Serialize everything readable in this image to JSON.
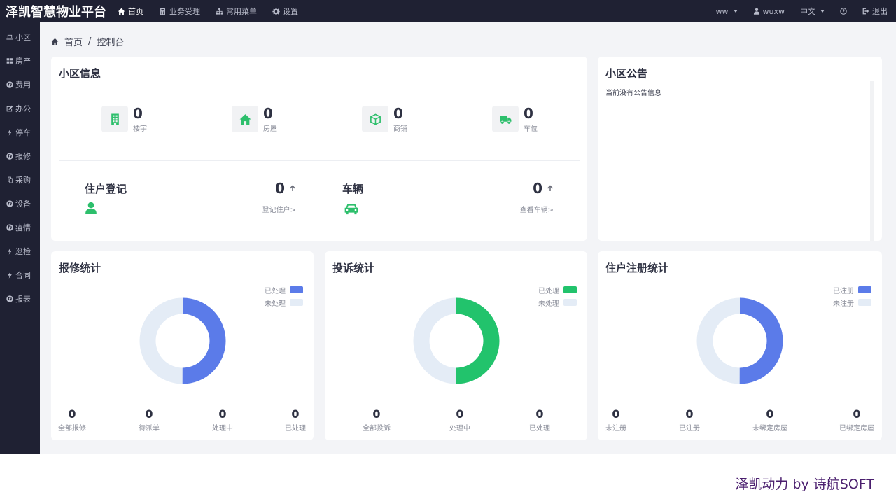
{
  "app": {
    "title": "泽凯智慧物业平台"
  },
  "topnav": [
    {
      "label": "首页",
      "icon": "home-icon",
      "active": true
    },
    {
      "label": "业务受理",
      "icon": "calculator-icon",
      "active": false
    },
    {
      "label": "常用菜单",
      "icon": "sitemap-icon",
      "active": false
    },
    {
      "label": "设置",
      "icon": "gear-icon",
      "active": false
    }
  ],
  "rightnav": {
    "community": "ww",
    "user": "wuxw",
    "language": "中文",
    "help_icon": "question-icon",
    "logout": "退出"
  },
  "sidebar": {
    "items": [
      {
        "label": "小区",
        "icon": "laptop-icon"
      },
      {
        "label": "房产",
        "icon": "grid-icon"
      },
      {
        "label": "费用",
        "icon": "globe-icon"
      },
      {
        "label": "办公",
        "icon": "edit-icon"
      },
      {
        "label": "停车",
        "icon": "bolt-icon"
      },
      {
        "label": "报修",
        "icon": "globe-icon"
      },
      {
        "label": "采购",
        "icon": "copy-icon"
      },
      {
        "label": "设备",
        "icon": "globe-icon"
      },
      {
        "label": "疫情",
        "icon": "globe-icon"
      },
      {
        "label": "巡检",
        "icon": "bolt-icon"
      },
      {
        "label": "合同",
        "icon": "bolt-icon"
      },
      {
        "label": "报表",
        "icon": "globe-icon"
      }
    ]
  },
  "breadcrumb": {
    "home": "首页",
    "sep": "/",
    "current": "控制台"
  },
  "community_info": {
    "title": "小区信息",
    "stats": [
      {
        "value": "0",
        "label": "楼宇",
        "icon": "building-icon"
      },
      {
        "value": "0",
        "label": "房屋",
        "icon": "house-icon"
      },
      {
        "value": "0",
        "label": "商铺",
        "icon": "cube-icon"
      },
      {
        "value": "0",
        "label": "车位",
        "icon": "truck-icon"
      }
    ],
    "resident": {
      "title": "住户登记",
      "value": "0",
      "link": "登记住户>",
      "icon": "user-icon"
    },
    "vehicle": {
      "title": "车辆",
      "value": "0",
      "link": "查看车辆>",
      "icon": "car-icon"
    }
  },
  "notice": {
    "title": "小区公告",
    "empty_text": "当前没有公告信息"
  },
  "repair_stats": {
    "title": "报修统计",
    "legend": [
      {
        "label": "已处理",
        "color": "#5b7be9"
      },
      {
        "label": "未处理",
        "color": "#e4ecf6"
      }
    ],
    "donut_fraction": 0.5,
    "footer": [
      {
        "value": "0",
        "label": "全部报修"
      },
      {
        "value": "0",
        "label": "待派单"
      },
      {
        "value": "0",
        "label": "处理中"
      },
      {
        "value": "0",
        "label": "已处理"
      }
    ]
  },
  "complaint_stats": {
    "title": "投诉统计",
    "legend": [
      {
        "label": "已处理",
        "color": "#22c36c"
      },
      {
        "label": "未处理",
        "color": "#e4ecf6"
      }
    ],
    "donut_fraction": 0.5,
    "footer": [
      {
        "value": "0",
        "label": "全部投诉"
      },
      {
        "value": "0",
        "label": "处理中"
      },
      {
        "value": "0",
        "label": "已处理"
      }
    ]
  },
  "owner_stats": {
    "title": "住户注册统计",
    "legend": [
      {
        "label": "已注册",
        "color": "#5b7be9"
      },
      {
        "label": "未注册",
        "color": "#e4ecf6"
      }
    ],
    "donut_fraction": 0.5,
    "footer": [
      {
        "value": "0",
        "label": "未注册"
      },
      {
        "value": "0",
        "label": "已注册"
      },
      {
        "value": "0",
        "label": "未绑定房屋"
      },
      {
        "value": "0",
        "label": "已绑定房屋"
      }
    ]
  },
  "watermark": "泽凯动力 by 诗航SOFT"
}
